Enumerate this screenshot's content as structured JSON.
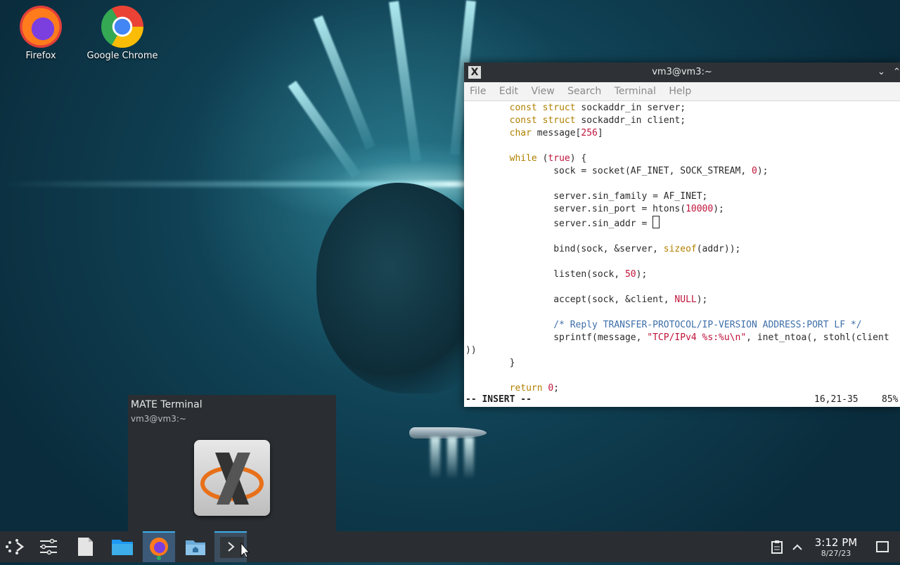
{
  "desktop": {
    "icons": [
      {
        "label": "Firefox"
      },
      {
        "label": "Google Chrome"
      }
    ]
  },
  "terminal": {
    "title": "vm3@vm3:~",
    "menu": [
      "File",
      "Edit",
      "View",
      "Search",
      "Terminal",
      "Help"
    ],
    "code_lines": [
      "        const struct sockaddr_in server;",
      "        const struct sockaddr_in client;",
      "        char message[256]",
      "",
      "        while (true) {",
      "                sock = socket(AF_INET, SOCK_STREAM, 0);",
      "",
      "                server.sin_family = AF_INET;",
      "                server.sin_port = htons(10000);",
      "                server.sin_addr = ",
      "",
      "                bind(sock, &server, sizeof(addr));",
      "",
      "                listen(sock, 50);",
      "",
      "                accept(sock, &client, NULL);",
      "",
      "                /* Reply TRANSFER-PROTOCOL/IP-VERSION ADDRESS:PORT LF */",
      "                sprintf(message, \"TCP/IPv4 %s:%u\\n\", inet_ntoa(, stohl(client",
      "))",
      "        }",
      "",
      "        return 0;"
    ],
    "mode": "-- INSERT --",
    "position": "16,21-35",
    "scroll": "85%"
  },
  "preview": {
    "title": "MATE Terminal",
    "subtitle": "vm3@vm3:~"
  },
  "taskbar": {
    "items": [
      {
        "icon": "application-launcher-icon"
      },
      {
        "icon": "pager-icon"
      },
      {
        "icon": "text-editor-icon"
      },
      {
        "icon": "file-manager-icon"
      },
      {
        "icon": "firefox-icon"
      },
      {
        "icon": "home-folder-icon"
      },
      {
        "icon": "terminal-icon"
      }
    ],
    "clock_time": "3:12 PM",
    "clock_date": "8/27/23"
  },
  "colors": {
    "accent": "#3daee9",
    "panel": "#2a2e32",
    "keyword": "#b08000",
    "number": "#c0133a",
    "comment": "#3d6ea8"
  }
}
